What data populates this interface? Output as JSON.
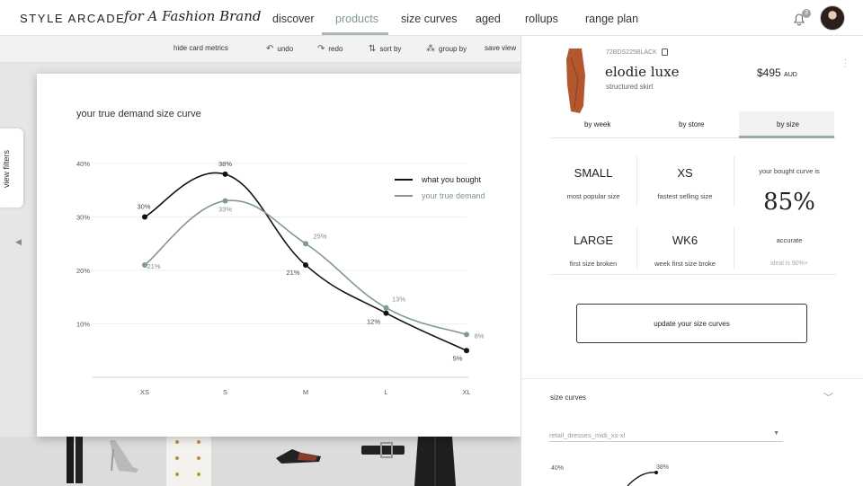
{
  "brand": {
    "name": "STYLE ARCADE",
    "tagline": "for A Fashion Brand"
  },
  "nav": {
    "items": [
      "discover",
      "products",
      "size curves",
      "aged",
      "rollups",
      "range plan"
    ],
    "active": "products"
  },
  "notifications": {
    "count": "3"
  },
  "toolbar": {
    "hide_metrics": "hide card metrics",
    "undo": "undo",
    "redo": "redo",
    "sort_by": "sort by",
    "group_by": "group by",
    "save_view": "save view"
  },
  "filters": {
    "label": "view filters"
  },
  "modal": {
    "title": "your true demand size curve"
  },
  "chart_data": {
    "type": "line",
    "title": "your true demand size curve",
    "categories": [
      "XS",
      "S",
      "M",
      "L",
      "XL"
    ],
    "yticks": [
      "10%",
      "20%",
      "30%",
      "40%"
    ],
    "ylim": [
      0,
      40
    ],
    "series": [
      {
        "name": "what you bought",
        "color": "#111111",
        "values": [
          30,
          38,
          21,
          12,
          5
        ],
        "labels": [
          "30%",
          "38%",
          "21%",
          "12%",
          "5%"
        ]
      },
      {
        "name": "your true demand",
        "color": "#819a8c",
        "values": [
          21,
          33,
          25,
          13,
          8
        ],
        "labels": [
          "21%",
          "33%",
          "25%",
          "13%",
          "8%"
        ]
      }
    ],
    "legend": "top-right",
    "grid": true
  },
  "product": {
    "sku": "72BDS225BLACK",
    "name": "elodie luxe",
    "subtitle": "structured skirt",
    "price": "$495",
    "currency": "AUD",
    "tabs": [
      "by week",
      "by store",
      "by size"
    ],
    "active_tab": "by size"
  },
  "metrics": {
    "popular_value": "SMALL",
    "popular_label": "most popular size",
    "fastest_value": "XS",
    "fastest_label": "fastest selling size",
    "broken_value": "LARGE",
    "broken_label": "first size broken",
    "week_value": "WK6",
    "week_label": "week first size broke",
    "curve_label": "your bought curve is",
    "curve_pct": "85%",
    "accurate_label": "accurate",
    "ideal_label": "ideal is 90%+"
  },
  "update_button": "update your size curves",
  "size_curves": {
    "title": "size curves",
    "selected": "retail_dresses_midi_xs-xl",
    "mini_ytick": "40%",
    "mini_label": "38%"
  }
}
